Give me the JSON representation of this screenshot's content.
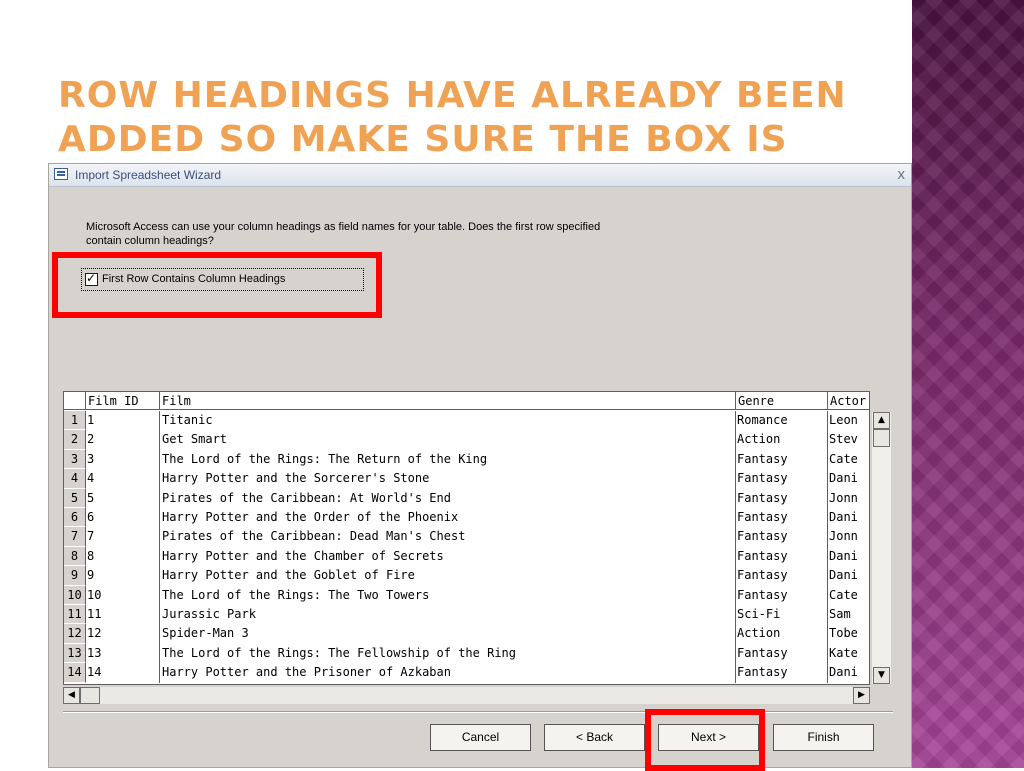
{
  "slide": {
    "title": "Row headings have already been added so make sure the box is ticked"
  },
  "dialog": {
    "title": "Import Spreadsheet Wizard",
    "close_glyph": "x",
    "prompt": "Microsoft Access can use your column headings as field names for your table. Does the first row specified contain column headings?",
    "checkbox": {
      "label": "First Row Contains Column Headings",
      "checked": true,
      "check_glyph": "✓"
    }
  },
  "grid": {
    "columns": [
      "Film ID",
      "Film",
      "Genre",
      "Actor"
    ],
    "rows": [
      {
        "n": "1",
        "id": "1",
        "film": "Titanic",
        "genre": "Romance",
        "actor": "Leon"
      },
      {
        "n": "2",
        "id": "2",
        "film": "Get Smart",
        "genre": "Action",
        "actor": "Stev"
      },
      {
        "n": "3",
        "id": "3",
        "film": "The Lord of the Rings: The Return of the King",
        "genre": "Fantasy",
        "actor": "Cate"
      },
      {
        "n": "4",
        "id": "4",
        "film": "Harry Potter and the Sorcerer's Stone",
        "genre": "Fantasy",
        "actor": "Dani"
      },
      {
        "n": "5",
        "id": "5",
        "film": "Pirates of the Caribbean: At World's End",
        "genre": "Fantasy",
        "actor": "Jonn"
      },
      {
        "n": "6",
        "id": "6",
        "film": "Harry Potter and the Order of the Phoenix",
        "genre": "Fantasy",
        "actor": "Dani"
      },
      {
        "n": "7",
        "id": "7",
        "film": "Pirates of the Caribbean: Dead Man's Chest",
        "genre": "Fantasy",
        "actor": "Jonn"
      },
      {
        "n": "8",
        "id": "8",
        "film": "Harry Potter and the Chamber of Secrets",
        "genre": "Fantasy",
        "actor": "Dani"
      },
      {
        "n": "9",
        "id": "9",
        "film": "Harry Potter and the Goblet of Fire",
        "genre": "Fantasy",
        "actor": "Dani"
      },
      {
        "n": "10",
        "id": "10",
        "film": "The Lord of the Rings: The Two Towers",
        "genre": "Fantasy",
        "actor": "Cate"
      },
      {
        "n": "11",
        "id": "11",
        "film": "Jurassic Park",
        "genre": "Sci-Fi",
        "actor": "Sam"
      },
      {
        "n": "12",
        "id": "12",
        "film": "Spider-Man 3",
        "genre": "Action",
        "actor": "Tobe"
      },
      {
        "n": "13",
        "id": "13",
        "film": "The Lord of the Rings: The Fellowship of the Ring",
        "genre": "Fantasy",
        "actor": "Kate"
      },
      {
        "n": "14",
        "id": "14",
        "film": "Harry Potter and the Prisoner of Azkaban",
        "genre": "Fantasy",
        "actor": "Dani"
      }
    ]
  },
  "scroll": {
    "up": "▲",
    "down": "▼",
    "left": "◀",
    "right": "▶"
  },
  "buttons": {
    "cancel": "Cancel",
    "back": "< Back",
    "next": "Next >",
    "finish": "Finish"
  },
  "colors": {
    "title": "#f0a254",
    "highlight": "#ff0000",
    "dialog_bg": "#d6d3ce",
    "deco": "#7a2a6a"
  },
  "icons": {
    "app": "access-table-icon",
    "close": "close-icon"
  }
}
